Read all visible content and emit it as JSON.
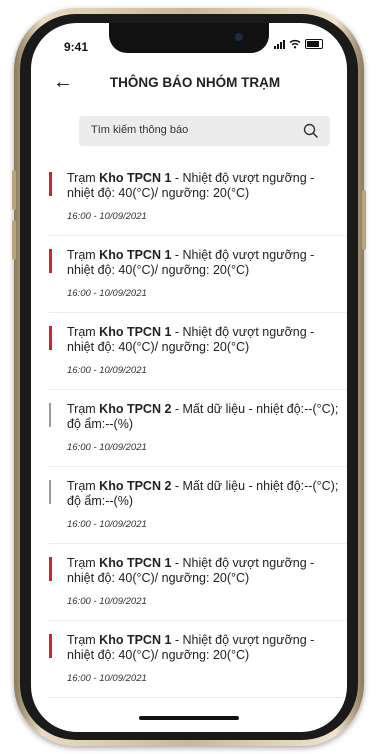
{
  "status": {
    "time": "9:41"
  },
  "header": {
    "title": "THÔNG BÁO NHÓM TRẠM",
    "back_icon": "arrow-left-icon"
  },
  "search": {
    "placeholder": "Tìm kiếm thông báo",
    "icon": "search-icon"
  },
  "colors": {
    "alert": "#d0232a",
    "neutral": "#9a9a9a"
  },
  "notifications": [
    {
      "prefix": "Trạm ",
      "station": "Kho TPCN 1",
      "text": " - Nhiệt độ vượt ngưỡng - nhiệt độ: 40(°C)/ ngưỡng: 20(°C)",
      "time": "16:00 - 10/09/2021",
      "level": "alert"
    },
    {
      "prefix": "Trạm ",
      "station": "Kho TPCN 1",
      "text": " - Nhiệt độ vượt ngưỡng - nhiệt độ: 40(°C)/ ngưỡng: 20(°C)",
      "time": "16:00 - 10/09/2021",
      "level": "alert"
    },
    {
      "prefix": "Trạm ",
      "station": "Kho TPCN 1",
      "text": " - Nhiệt độ vượt ngưỡng - nhiệt độ: 40(°C)/ ngưỡng: 20(°C)",
      "time": "16:00 - 10/09/2021",
      "level": "alert"
    },
    {
      "prefix": "Trạm ",
      "station": "Kho TPCN 2",
      "text": " - Mất dữ liệu - nhiệt độ:--(°C); độ ẩm:--(%)",
      "time": "16:00 - 10/09/2021",
      "level": "neutral"
    },
    {
      "prefix": "Trạm ",
      "station": "Kho TPCN 2",
      "text": " - Mất dữ liệu - nhiệt độ:--(°C); độ ẩm:--(%)",
      "time": "16:00 - 10/09/2021",
      "level": "neutral"
    },
    {
      "prefix": "Trạm ",
      "station": "Kho TPCN 1",
      "text": " - Nhiệt độ vượt ngưỡng - nhiệt độ: 40(°C)/ ngưỡng: 20(°C)",
      "time": "16:00 - 10/09/2021",
      "level": "alert"
    },
    {
      "prefix": "Trạm ",
      "station": "Kho TPCN 1",
      "text": " - Nhiệt độ vượt ngưỡng - nhiệt độ: 40(°C)/ ngưỡng: 20(°C)",
      "time": "16:00 - 10/09/2021",
      "level": "alert"
    }
  ]
}
